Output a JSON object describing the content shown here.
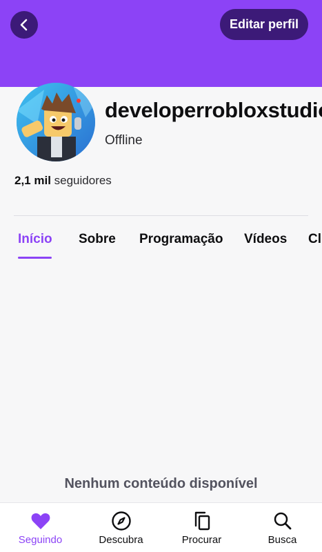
{
  "header": {
    "edit_label": "Editar perfil"
  },
  "profile": {
    "username": "developerrobloxstudio",
    "status": "Offline",
    "followers_count": "2,1 mil",
    "followers_label": " seguidores"
  },
  "tabs": [
    {
      "label": "Início",
      "active": true
    },
    {
      "label": "Sobre",
      "active": false
    },
    {
      "label": "Programação",
      "active": false
    },
    {
      "label": "Vídeos",
      "active": false
    },
    {
      "label": "Clipes",
      "active": false
    }
  ],
  "content": {
    "empty_message": "Nenhum conteúdo disponível"
  },
  "bottom_nav": [
    {
      "label": "Seguindo",
      "icon": "heart-icon",
      "active": true
    },
    {
      "label": "Descubra",
      "icon": "compass-icon",
      "active": false
    },
    {
      "label": "Procurar",
      "icon": "copy-icon",
      "active": false
    },
    {
      "label": "Busca",
      "icon": "search-icon",
      "active": false
    }
  ],
  "colors": {
    "accent": "#8c43f6",
    "button_dark": "#3c1a78",
    "background": "#f7f7f8"
  }
}
